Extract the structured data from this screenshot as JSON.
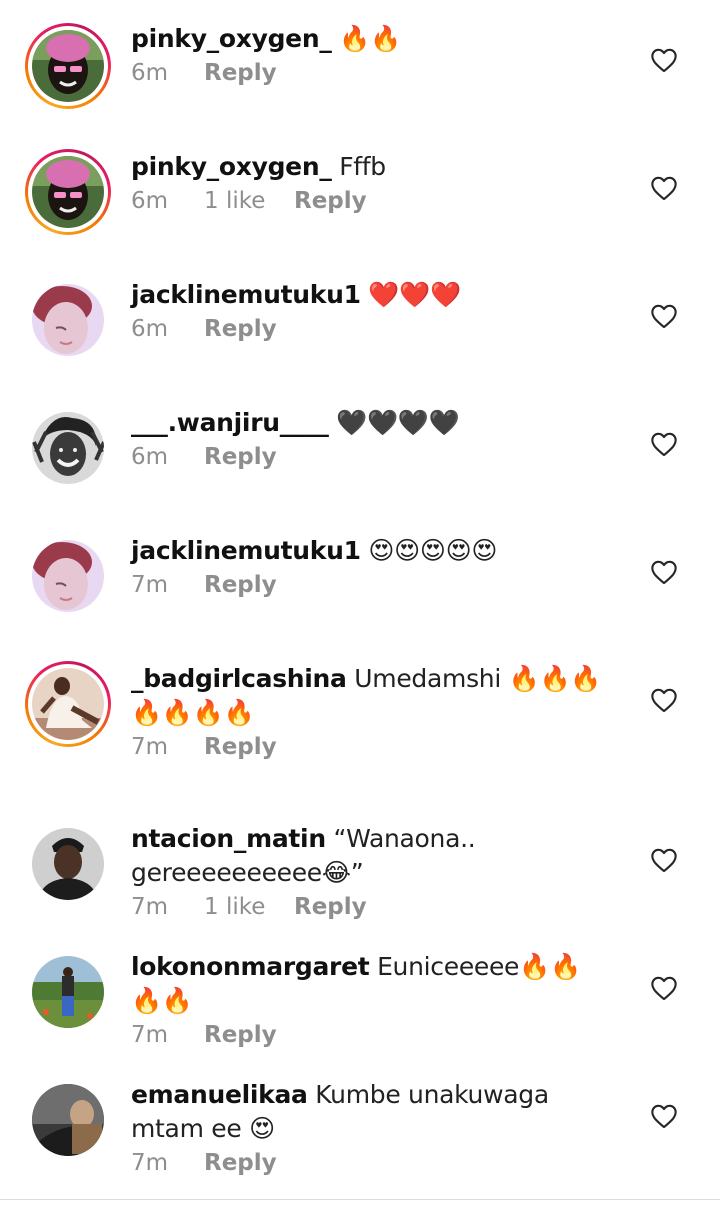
{
  "comments": [
    {
      "username": "pinky_oxygen_",
      "text": "🔥🔥",
      "time": "6m",
      "likes": "",
      "reply": "Reply",
      "ring": true,
      "avatar": "pinky"
    },
    {
      "username": "pinky_oxygen_",
      "text": "Fffb",
      "time": "6m",
      "likes": "1 like",
      "reply": "Reply",
      "ring": true,
      "avatar": "pinky"
    },
    {
      "username": "jacklinemutuku1",
      "text": "❤️❤️❤️",
      "time": "6m",
      "likes": "",
      "reply": "Reply",
      "ring": false,
      "avatar": "jackline"
    },
    {
      "username": "___.wanjiru____",
      "text": "🖤🖤🖤🖤",
      "time": "6m",
      "likes": "",
      "reply": "Reply",
      "ring": false,
      "avatar": "wanjiru"
    },
    {
      "username": "jacklinemutuku1",
      "text": "😍😍😍😍😍",
      "time": "7m",
      "likes": "",
      "reply": "Reply",
      "ring": false,
      "avatar": "jackline"
    },
    {
      "username": "_badgirlcashina",
      "text": "Umedamshi 🔥🔥🔥🔥🔥🔥🔥",
      "time": "7m",
      "likes": "",
      "reply": "Reply",
      "ring": true,
      "avatar": "cashina"
    },
    {
      "username": "ntacion_matin",
      "text": "“Wanaona.. gereeeeeeeeee😂”",
      "time": "7m",
      "likes": "1 like",
      "reply": "Reply",
      "ring": false,
      "avatar": "matin"
    },
    {
      "username": "lokononmargaret",
      "text": "Euniceeeee🔥🔥🔥🔥",
      "time": "7m",
      "likes": "",
      "reply": "Reply",
      "ring": false,
      "avatar": "margaret"
    },
    {
      "username": "emanuelikaa",
      "text": "Kumbe unakuwaga mtam ee 😍",
      "time": "7m",
      "likes": "",
      "reply": "Reply",
      "ring": false,
      "avatar": "emanuel"
    }
  ],
  "icons": {
    "like": "heart-outline-icon"
  },
  "colors": {
    "secondary_text": "#8e8e8e",
    "primary_text": "#111111",
    "story_ring": "#e91e63"
  }
}
